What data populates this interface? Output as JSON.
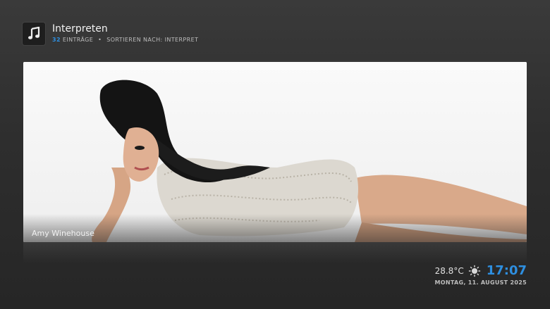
{
  "header": {
    "icon": "music-note-icon",
    "title": "Interpreten",
    "count": "32",
    "entries_label": "EINTRÄGE",
    "separator": "•",
    "sort_label": "SORTIEREN NACH: INTERPRET"
  },
  "panel": {
    "caption": "Amy Winehouse"
  },
  "footer": {
    "temperature": "28.8°C",
    "weather_icon": "sun-icon",
    "time": "17:07",
    "date": "MONTAG, 11. AUGUST 2025"
  },
  "colors": {
    "accent": "#2e8fe0",
    "background": "#2e2e2e"
  }
}
